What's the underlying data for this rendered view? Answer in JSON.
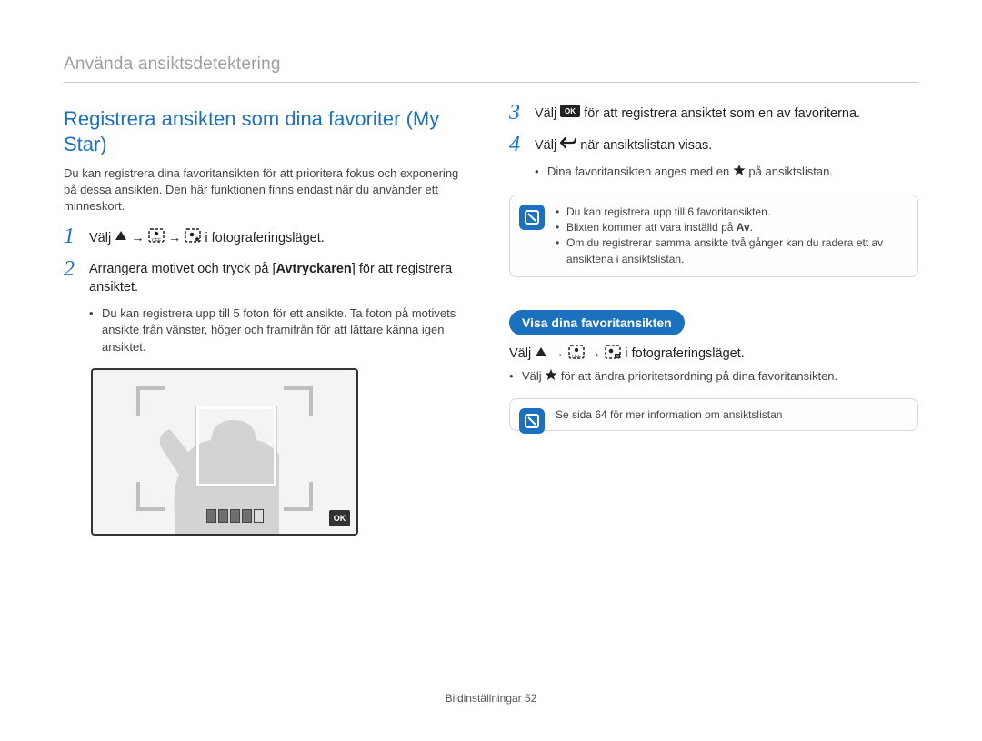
{
  "header": {
    "section_title": "Använda ansiktsdetektering"
  },
  "left": {
    "title": "Registrera ansikten som dina favoriter (My Star)",
    "intro": "Du kan registrera dina favoritansikten för att prioritera fokus och exponering på dessa ansikten. Den här funktionen finns endast när du använder ett minneskort.",
    "step1": {
      "prefix": "Välj ",
      "suffix": " i fotograferingsläget."
    },
    "step2": {
      "line_a": "Arrangera motivet och tryck på [",
      "bold": "Avtryckaren",
      "line_b": "] för att registrera ansiktet.",
      "bullet": "Du kan registrera upp till 5 foton för ett ansikte. Ta foton på motivets ansikte från vänster, höger och framifrån för att lättare känna igen ansiktet."
    }
  },
  "right": {
    "step3": {
      "prefix": "Välj ",
      "suffix": " för att registrera ansiktet som en av favoriterna."
    },
    "step4": {
      "prefix": "Välj ",
      "suffix": " när ansiktslistan visas.",
      "bullet_prefix": "Dina favoritansikten anges med en ",
      "bullet_suffix": " på ansiktslistan."
    },
    "tipbox1": {
      "l1": "Du kan registrera upp till 6 favoritansikten.",
      "l2_a": "Blixten kommer att vara inställd på ",
      "l2_b": "Av",
      "l2_c": ".",
      "l3": "Om du registrerar samma ansikte två gånger kan du radera ett av ansiktena i ansiktslistan."
    },
    "pill": "Visa dina favoritansikten",
    "select_line": {
      "prefix": "Välj ",
      "suffix": " i fotograferingsläget."
    },
    "bullet2_prefix": "Välj ",
    "bullet2_suffix": " för att ändra prioritetsordning på dina favoritansikten.",
    "tipbox2": "Se sida 64 för mer information om ansiktslistan"
  },
  "footer": {
    "label": "Bildinställningar",
    "page": "52"
  }
}
